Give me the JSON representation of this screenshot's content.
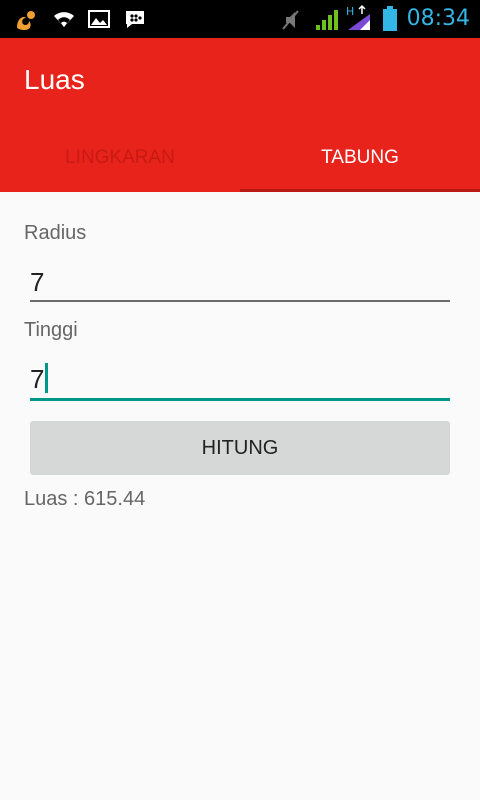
{
  "status_bar": {
    "time": "08:34",
    "icons": [
      "uc-browser-icon",
      "wifi-icon",
      "image-icon",
      "bbm-icon",
      "mute-icon",
      "signal-icon",
      "hspa-signal-icon",
      "battery-icon"
    ]
  },
  "app": {
    "title": "Luas"
  },
  "tabs": [
    {
      "label": "LINGKARAN",
      "selected": false
    },
    {
      "label": "TABUNG",
      "selected": true
    }
  ],
  "form": {
    "radius_label": "Radius",
    "radius_value": "7",
    "tinggi_label": "Tinggi",
    "tinggi_value": "7",
    "button_label": "HITUNG",
    "result_text": "Luas : 615.44"
  },
  "colors": {
    "accent": "#e8231b",
    "focus": "#009688",
    "status_time": "#33b5e5"
  }
}
